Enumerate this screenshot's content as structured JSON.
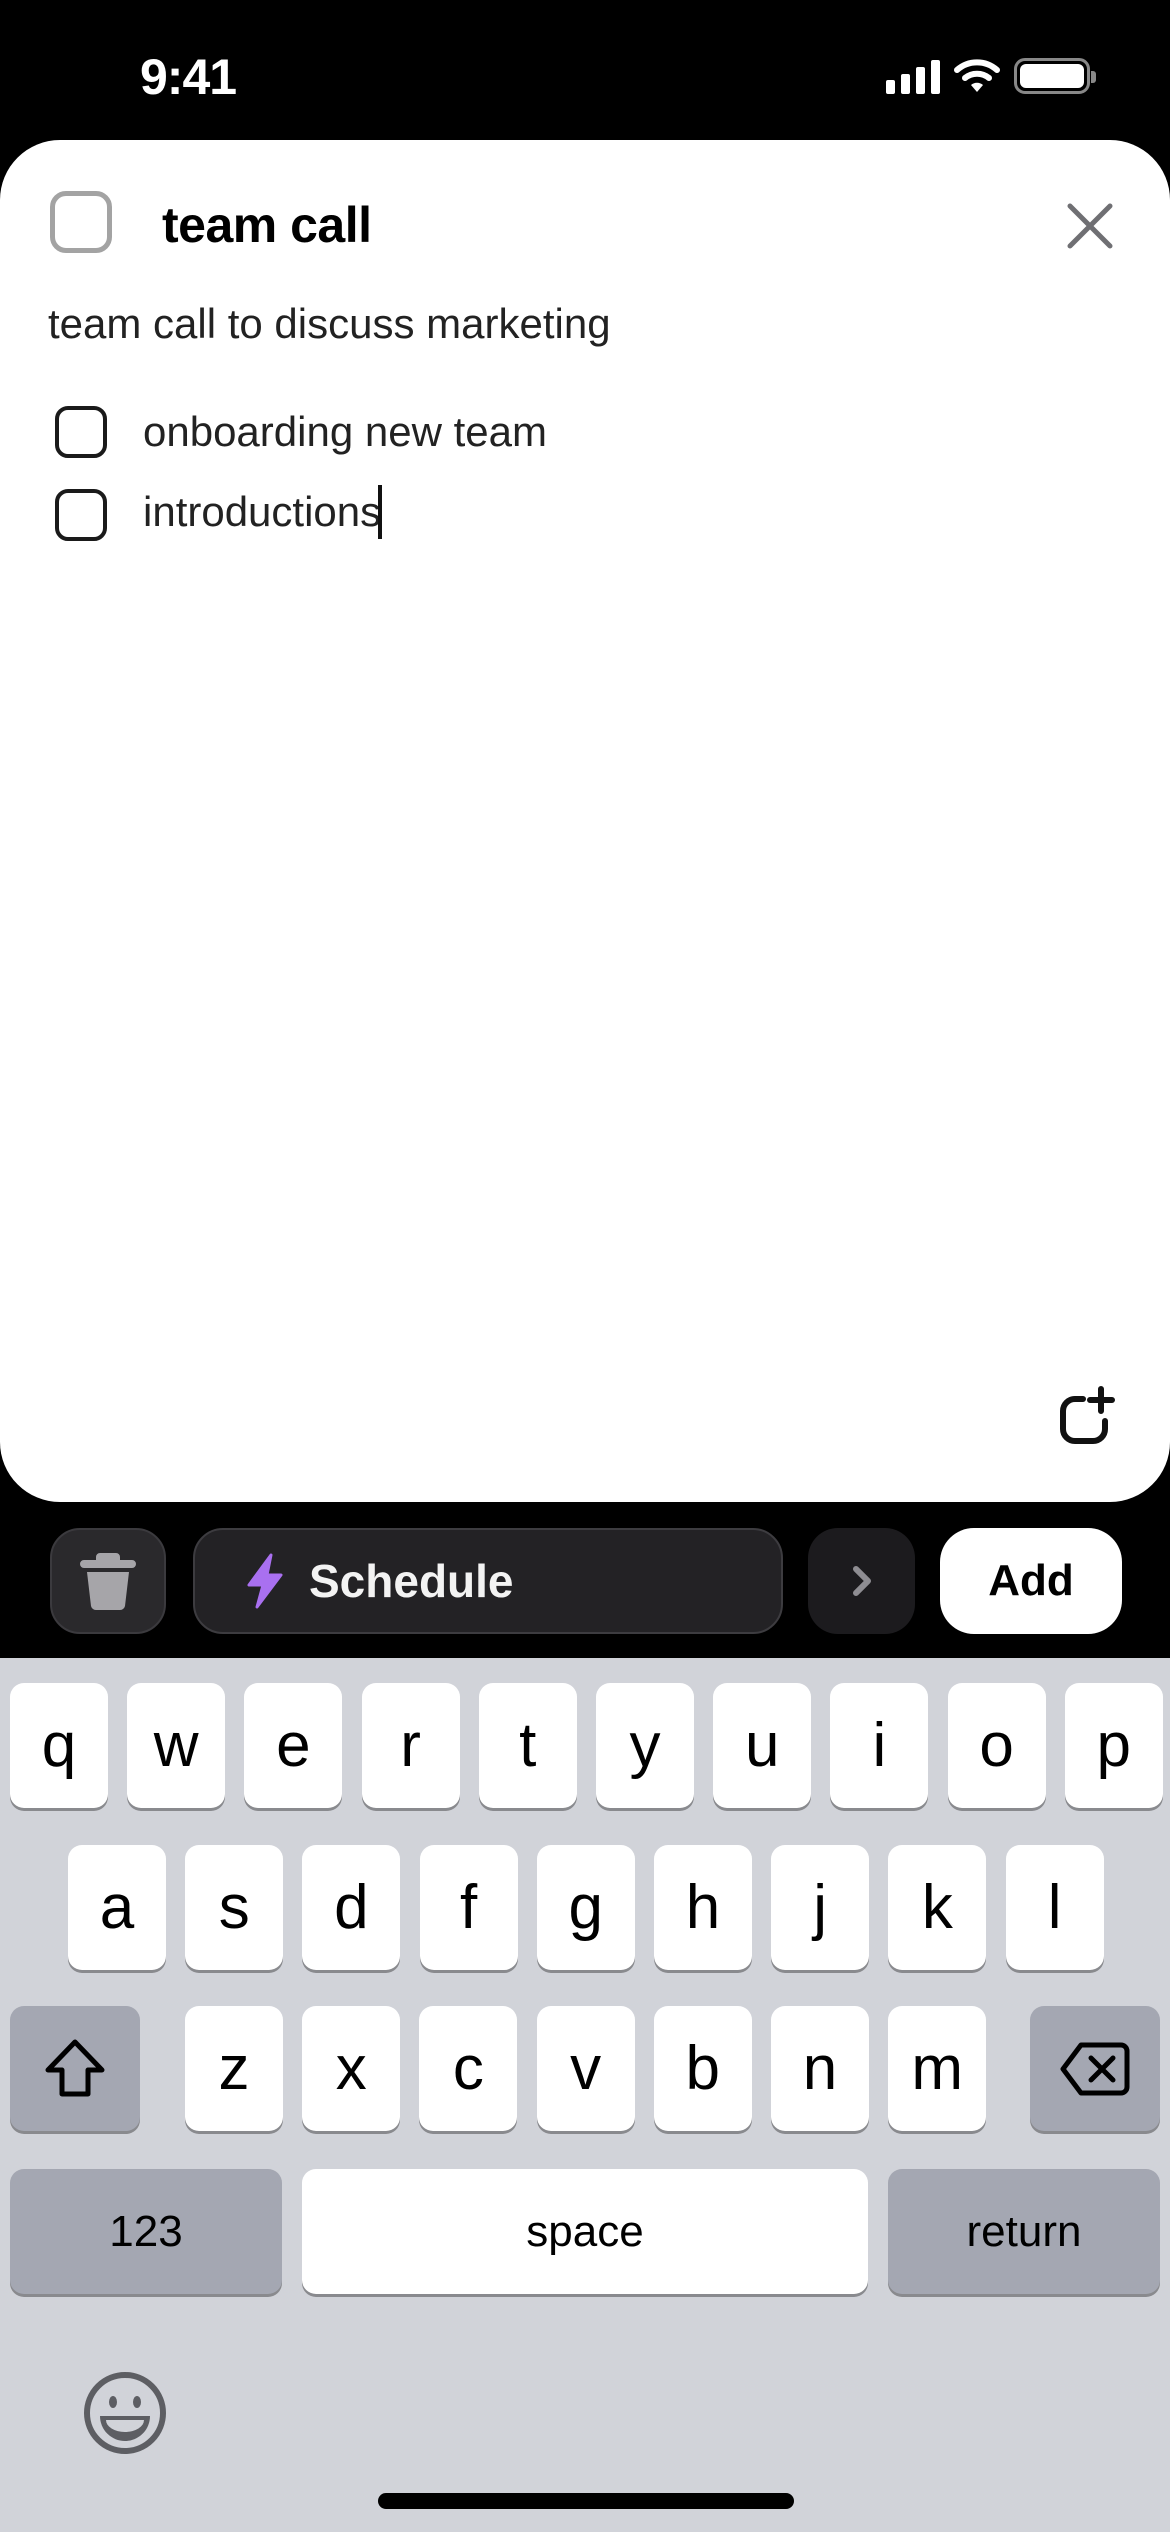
{
  "status_bar": {
    "time": "9:41",
    "icons": [
      "cellular-signal-icon",
      "wifi-icon",
      "battery-icon"
    ]
  },
  "task": {
    "title": "team call",
    "completed": false,
    "description": "team call to discuss marketing",
    "subtasks": [
      {
        "label": "onboarding new team",
        "completed": false
      },
      {
        "label": "introductions",
        "completed": false,
        "editing": true
      }
    ],
    "close_icon": "close-icon",
    "add_subtask_icon": "add-subtask-icon"
  },
  "toolbar": {
    "delete_icon": "trash-icon",
    "schedule_label": "Schedule",
    "schedule_icon": "lightning-bolt-icon",
    "schedule_icon_color": "#a970f0",
    "next_icon": "chevron-right-icon",
    "add_label": "Add"
  },
  "keyboard": {
    "row1": [
      "q",
      "w",
      "e",
      "r",
      "t",
      "y",
      "u",
      "i",
      "o",
      "p"
    ],
    "row2": [
      "a",
      "s",
      "d",
      "f",
      "g",
      "h",
      "j",
      "k",
      "l"
    ],
    "row3": [
      "z",
      "x",
      "c",
      "v",
      "b",
      "n",
      "m"
    ],
    "shift_icon": "shift-icon",
    "backspace_icon": "backspace-icon",
    "numbers_label": "123",
    "space_label": "space",
    "return_label": "return",
    "emoji_icon": "emoji-icon"
  }
}
